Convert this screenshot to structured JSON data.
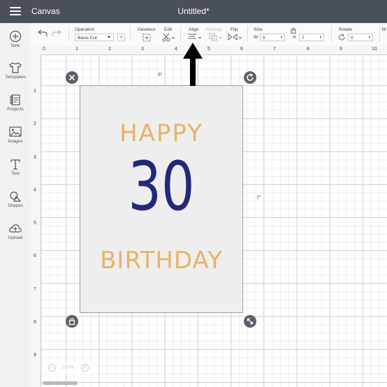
{
  "topbar": {
    "app_title": "Canvas",
    "doc_title": "Untitled*"
  },
  "leftrail": {
    "items": [
      {
        "label": "New",
        "icon": "plus-circle-icon"
      },
      {
        "label": "Templates",
        "icon": "tshirt-icon"
      },
      {
        "label": "Projects",
        "icon": "projects-icon"
      },
      {
        "label": "Images",
        "icon": "image-icon"
      },
      {
        "label": "Text",
        "icon": "text-t-icon"
      },
      {
        "label": "Shapes",
        "icon": "shapes-icon"
      },
      {
        "label": "Upload",
        "icon": "cloud-upload-icon"
      }
    ]
  },
  "toolbar": {
    "operation_label": "Operation",
    "operation_value": "Basic Cut",
    "help_label": "?",
    "deselect_label": "Deselect",
    "edit_label": "Edit",
    "align_label": "Align",
    "arrange_label": "Arrange",
    "flip_label": "Flip",
    "size_label": "Size",
    "w_label": "W",
    "w_value": "5",
    "h_label": "H",
    "h_value": "7",
    "rotate_label": "Rotate",
    "rotate_value": "0",
    "more_label": "M"
  },
  "ruler": {
    "top": [
      "0",
      "1",
      "2",
      "3",
      "4",
      "5",
      "6",
      "7",
      "8",
      "9",
      "10"
    ],
    "left": [
      "1",
      "2",
      "3",
      "4",
      "5",
      "6",
      "7",
      "8",
      "9"
    ]
  },
  "card": {
    "line1": "HAPPY",
    "line2": "30",
    "line3": "BIRTHDAY"
  },
  "dimensions": {
    "width_label": "5\"",
    "height_label": "7\""
  },
  "zoom": {
    "value": "100%",
    "minus": "−",
    "plus": "+"
  },
  "colors": {
    "accent_gold": "#e7b36a",
    "navy": "#23287a",
    "topbar": "#4a5057"
  }
}
